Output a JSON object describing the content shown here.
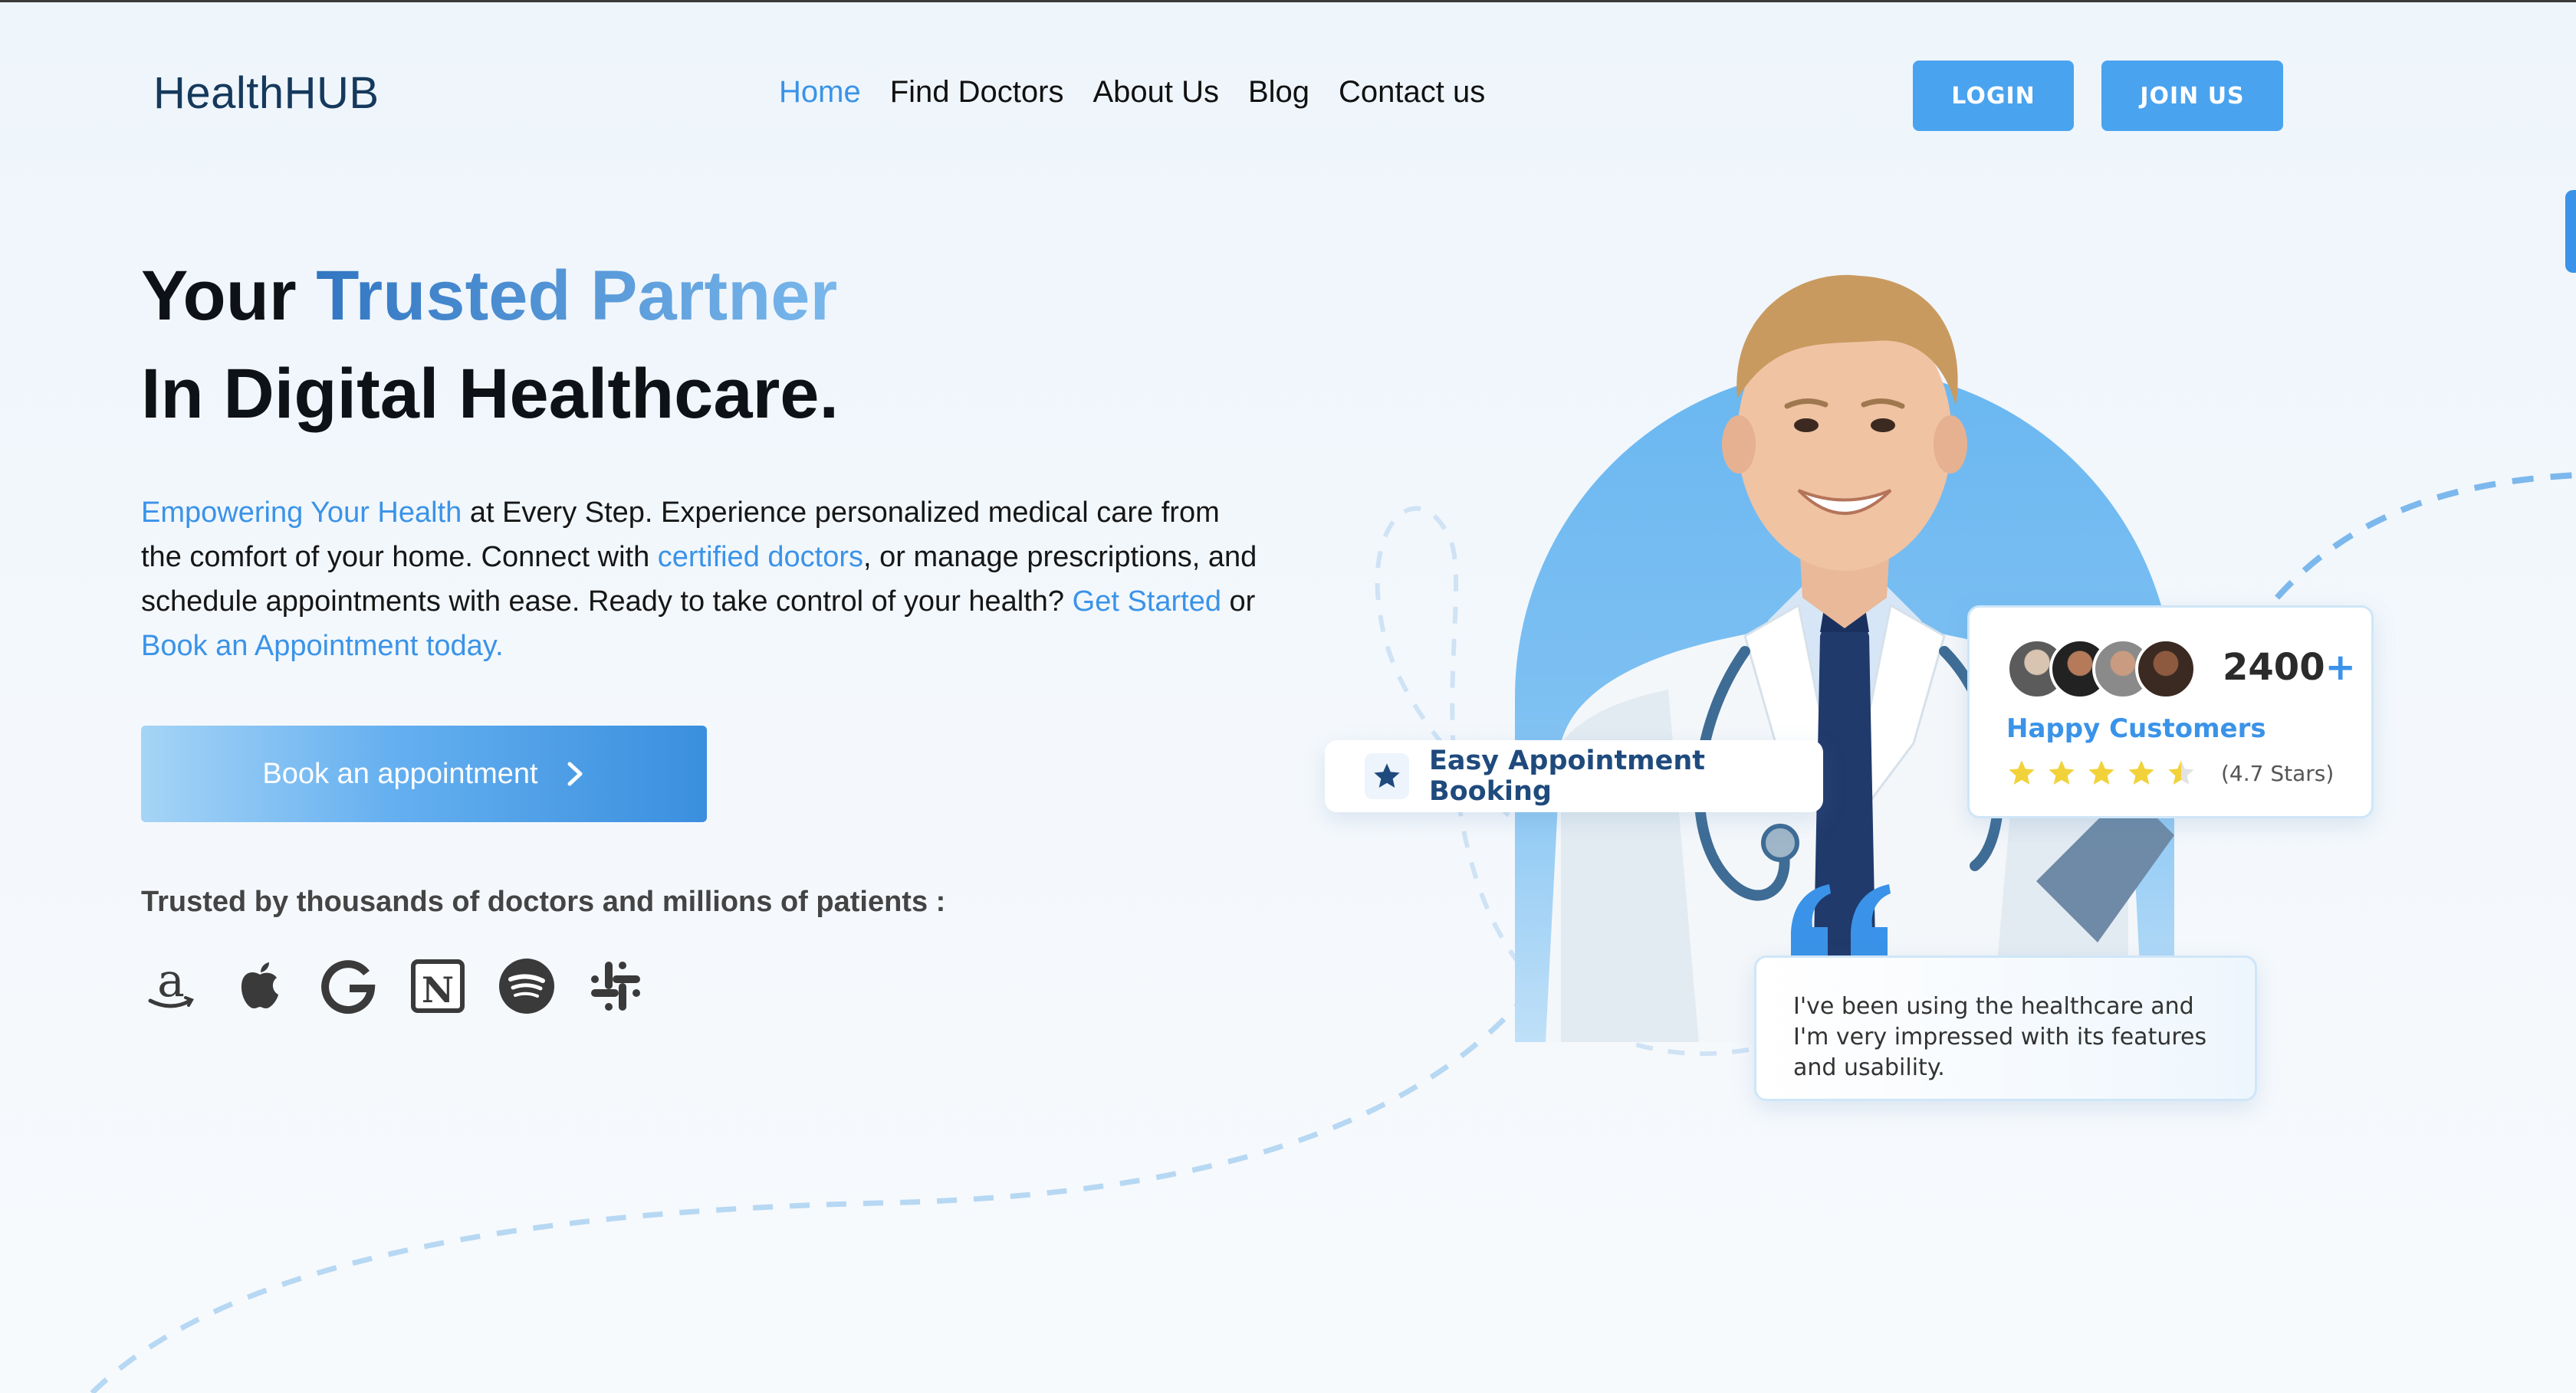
{
  "header": {
    "logo": "HealthHUB",
    "nav": [
      {
        "label": "Home",
        "active": true
      },
      {
        "label": "Find Doctors",
        "active": false
      },
      {
        "label": "About Us",
        "active": false
      },
      {
        "label": "Blog",
        "active": false
      },
      {
        "label": "Contact us",
        "active": false
      }
    ],
    "login_label": "LOGIN",
    "join_label": "JOIN US"
  },
  "hero": {
    "title_part1": "Your ",
    "title_accent": "Trusted Partner",
    "title_line2": "In Digital Healthcare.",
    "desc": {
      "hl1": "Empowering Your Health",
      "t1": " at Every Step. Experience personalized medical care from the comfort of your home. Connect with ",
      "hl2": "certified doctors",
      "t2": ", or manage prescriptions, and schedule appointments with ease. Ready to take control of your health? ",
      "hl3": "Get Started",
      "t3": " or ",
      "hl4": "Book an Appointment today."
    },
    "book_button": "Book an appointment",
    "trusted_text": "Trusted by thousands of doctors and millions of patients :"
  },
  "brands": [
    "amazon-icon",
    "apple-icon",
    "google-icon",
    "notion-icon",
    "spotify-icon",
    "slack-icon"
  ],
  "cards": {
    "booking": "Easy Appointment Booking",
    "customers_count": "2400",
    "customers_plus": "+",
    "customers_label": "Happy Customers",
    "rating": 4.5,
    "rating_text": "(4.7 Stars)",
    "testimonial": "I've been using the healthcare  and I'm very impressed with its features and usability."
  },
  "colors": {
    "accent": "#3a93e8",
    "button": "#4aa3ef",
    "navy": "#15395c",
    "star": "#f2d23a"
  }
}
